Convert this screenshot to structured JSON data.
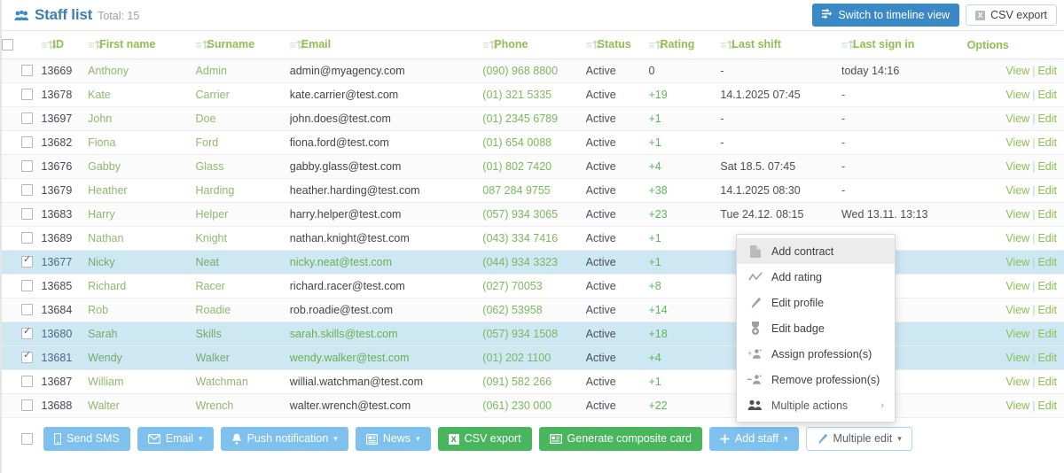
{
  "header": {
    "icon": "people-group-icon",
    "title": "Staff list",
    "total_label": "Total: 15",
    "switch_timeline_label": "Switch to timeline view",
    "switch_timeline_icon": "timeline-icon",
    "csv_export_label": "CSV export",
    "csv_export_icon": "excel-x-icon",
    "accent_blue": "#3a88c4",
    "title_color": "#3f7fb0"
  },
  "table": {
    "sort_icon": "sort-icon",
    "columns": [
      {
        "key": "chk",
        "label": "",
        "sortable": false
      },
      {
        "key": "id",
        "label": "ID",
        "sortable": true
      },
      {
        "key": "first",
        "label": "First name",
        "sortable": true
      },
      {
        "key": "last",
        "label": "Surname",
        "sortable": true
      },
      {
        "key": "email",
        "label": "Email",
        "sortable": true
      },
      {
        "key": "phone",
        "label": "Phone",
        "sortable": true
      },
      {
        "key": "status",
        "label": "Status",
        "sortable": true
      },
      {
        "key": "rating",
        "label": "Rating",
        "sortable": true
      },
      {
        "key": "shift",
        "label": "Last shift",
        "sortable": true
      },
      {
        "key": "signin",
        "label": "Last sign in",
        "sortable": true
      },
      {
        "key": "opts",
        "label": "Options",
        "sortable": false
      }
    ],
    "options_view": "View",
    "options_edit": "Edit",
    "rows": [
      {
        "selected": false,
        "id": "13669",
        "first": "Anthony",
        "last": "Admin",
        "email": "admin@myagency.com",
        "email_green": false,
        "phone": "(090) 968 8800",
        "status": "Active",
        "rating": "0",
        "shift": "-",
        "signin": "today 14:16"
      },
      {
        "selected": false,
        "id": "13678",
        "first": "Kate",
        "last": "Carrier",
        "email": "kate.carrier@test.com",
        "email_green": false,
        "phone": "(01) 321 5335",
        "status": "Active",
        "rating": "+19",
        "shift": "14.1.2025 07:45",
        "signin": "-"
      },
      {
        "selected": false,
        "id": "13697",
        "first": "John",
        "last": "Doe",
        "email": "john.does@test.com",
        "email_green": false,
        "phone": "(01) 2345 6789",
        "status": "Active",
        "rating": "+1",
        "shift": "-",
        "signin": "-"
      },
      {
        "selected": false,
        "id": "13682",
        "first": "Fiona",
        "last": "Ford",
        "email": "fiona.ford@test.com",
        "email_green": false,
        "phone": "(01) 654 0088",
        "status": "Active",
        "rating": "+1",
        "shift": "-",
        "signin": "-"
      },
      {
        "selected": false,
        "id": "13676",
        "first": "Gabby",
        "last": "Glass",
        "email": "gabby.glass@test.com",
        "email_green": false,
        "phone": "(01) 802 7420",
        "status": "Active",
        "rating": "+4",
        "shift": "Sat 18.5. 07:45",
        "signin": "-"
      },
      {
        "selected": false,
        "id": "13679",
        "first": "Heather",
        "last": "Harding",
        "email": "heather.harding@test.com",
        "email_green": false,
        "phone": "087 284 9755",
        "status": "Active",
        "rating": "+38",
        "shift": "14.1.2025 08:30",
        "signin": "-"
      },
      {
        "selected": false,
        "id": "13683",
        "first": "Harry",
        "last": "Helper",
        "email": "harry.helper@test.com",
        "email_green": false,
        "phone": "(057) 934 3065",
        "status": "Active",
        "rating": "+23",
        "shift": "Tue 24.12. 08:15",
        "signin": "Wed 13.11. 13:13"
      },
      {
        "selected": false,
        "id": "13689",
        "first": "Nathan",
        "last": "Knight",
        "email": "nathan.knight@test.com",
        "email_green": false,
        "phone": "(043) 334 7416",
        "status": "Active",
        "rating": "+1",
        "shift": "",
        "signin": ""
      },
      {
        "selected": true,
        "id": "13677",
        "first": "Nicky",
        "last": "Neat",
        "email": "nicky.neat@test.com",
        "email_green": true,
        "phone": "(044) 934 3323",
        "status": "Active",
        "rating": "+1",
        "shift": "",
        "signin": ""
      },
      {
        "selected": false,
        "id": "13685",
        "first": "Richard",
        "last": "Racer",
        "email": "richard.racer@test.com",
        "email_green": false,
        "phone": "(027) 70053",
        "status": "Active",
        "rating": "+8",
        "shift": "",
        "signin": ""
      },
      {
        "selected": false,
        "id": "13684",
        "first": "Rob",
        "last": "Roadie",
        "email": "rob.roadie@test.com",
        "email_green": false,
        "phone": "(062) 53958",
        "status": "Active",
        "rating": "+14",
        "shift": "",
        "signin": ""
      },
      {
        "selected": true,
        "id": "13680",
        "first": "Sarah",
        "last": "Skills",
        "email": "sarah.skills@test.com",
        "email_green": true,
        "phone": "(057) 934 1508",
        "status": "Active",
        "rating": "+18",
        "shift": "",
        "signin": ""
      },
      {
        "selected": true,
        "id": "13681",
        "first": "Wendy",
        "last": "Walker",
        "email": "wendy.walker@test.com",
        "email_green": true,
        "phone": "(01) 202 1100",
        "status": "Active",
        "rating": "+4",
        "shift": "",
        "signin": ""
      },
      {
        "selected": false,
        "id": "13687",
        "first": "William",
        "last": "Watchman",
        "email": "willial.watchman@test.com",
        "email_green": false,
        "phone": "(091) 582 266",
        "status": "Active",
        "rating": "+1",
        "shift": "",
        "signin": ""
      },
      {
        "selected": false,
        "id": "13688",
        "first": "Walter",
        "last": "Wrench",
        "email": "walter.wrench@test.com",
        "email_green": false,
        "phone": "(061) 230 000",
        "status": "Active",
        "rating": "+22",
        "shift": "",
        "signin": ""
      }
    ]
  },
  "context_menu": {
    "items": [
      {
        "label": "Add contract",
        "icon": "document-icon",
        "active": true,
        "submenu": false
      },
      {
        "label": "Add rating",
        "icon": "chart-line-icon",
        "active": false,
        "submenu": false
      },
      {
        "label": "Edit profile",
        "icon": "pencil-icon",
        "active": false,
        "submenu": false
      },
      {
        "label": "Edit badge",
        "icon": "badge-icon",
        "active": false,
        "submenu": false
      },
      {
        "label": "Assign profession(s)",
        "icon": "user-add-icon",
        "active": false,
        "submenu": false
      },
      {
        "label": "Remove profession(s)",
        "icon": "user-remove-icon",
        "active": false,
        "submenu": false
      },
      {
        "label": "Multiple actions",
        "icon": "users-icon",
        "active": false,
        "submenu": true,
        "arrow": "›"
      }
    ]
  },
  "bottom_toolbar": {
    "buttons": [
      {
        "label": "Send SMS",
        "icon": "phone-icon",
        "style": "blue",
        "caret": false
      },
      {
        "label": "Email",
        "icon": "envelope-icon",
        "style": "blue",
        "caret": true
      },
      {
        "label": "Push notification",
        "icon": "bell-icon",
        "style": "blue",
        "caret": true
      },
      {
        "label": "News",
        "icon": "news-icon",
        "style": "blue",
        "caret": true
      },
      {
        "label": "CSV export",
        "icon": "excel-x-icon",
        "style": "green",
        "caret": false
      },
      {
        "label": "Generate composite card",
        "icon": "id-card-icon",
        "style": "green",
        "caret": false
      },
      {
        "label": "Add staff",
        "icon": "plus-icon",
        "style": "blue",
        "caret": true
      },
      {
        "label": "Multiple edit",
        "icon": "pencil-icon",
        "style": "light",
        "caret": true
      }
    ],
    "caret_glyph": "▾"
  },
  "colors": {
    "green_text": "#8cc152",
    "selected_row": "#cde8f3",
    "blue_button": "#7ec0ee",
    "green_button": "#49b65d"
  }
}
